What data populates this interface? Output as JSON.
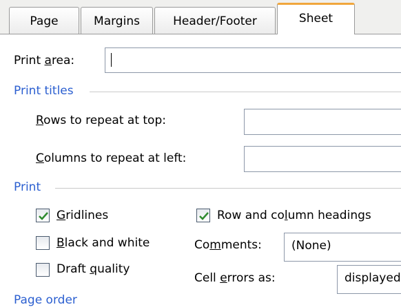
{
  "tabs": [
    {
      "label": "Page"
    },
    {
      "label": "Margins"
    },
    {
      "label": "Header/Footer"
    },
    {
      "label": "Sheet"
    }
  ],
  "print_area": {
    "pre": "Print ",
    "key": "a",
    "post": "rea:",
    "value": ""
  },
  "print_titles": {
    "section_label": "Print titles",
    "rows": {
      "key": "R",
      "post": "ows to repeat at top:",
      "value": ""
    },
    "columns": {
      "key": "C",
      "post": "olumns to repeat at left:",
      "value": ""
    }
  },
  "print": {
    "section_label": "Print",
    "gridlines": {
      "key": "G",
      "post": "ridlines",
      "checked": true
    },
    "black_and_white": {
      "key": "B",
      "post": "lack and white",
      "checked": false
    },
    "draft_quality": {
      "pre": "Draft ",
      "key": "q",
      "post": "uality",
      "checked": false
    },
    "row_col_headings": {
      "pre": "Row and co",
      "key": "l",
      "post": "umn headings",
      "checked": true
    },
    "comments": {
      "pre": "Co",
      "key": "m",
      "post": "ments:",
      "value": "(None)"
    },
    "cell_errors": {
      "pre": "Cell ",
      "key": "e",
      "post": "rrors as:",
      "value": "displayed"
    }
  },
  "page_order": {
    "section_label": "Page order"
  },
  "colors": {
    "accent_tab": "#f0a63c",
    "section_label": "#2b5fd0",
    "checkmark": "#2f8a2f"
  }
}
